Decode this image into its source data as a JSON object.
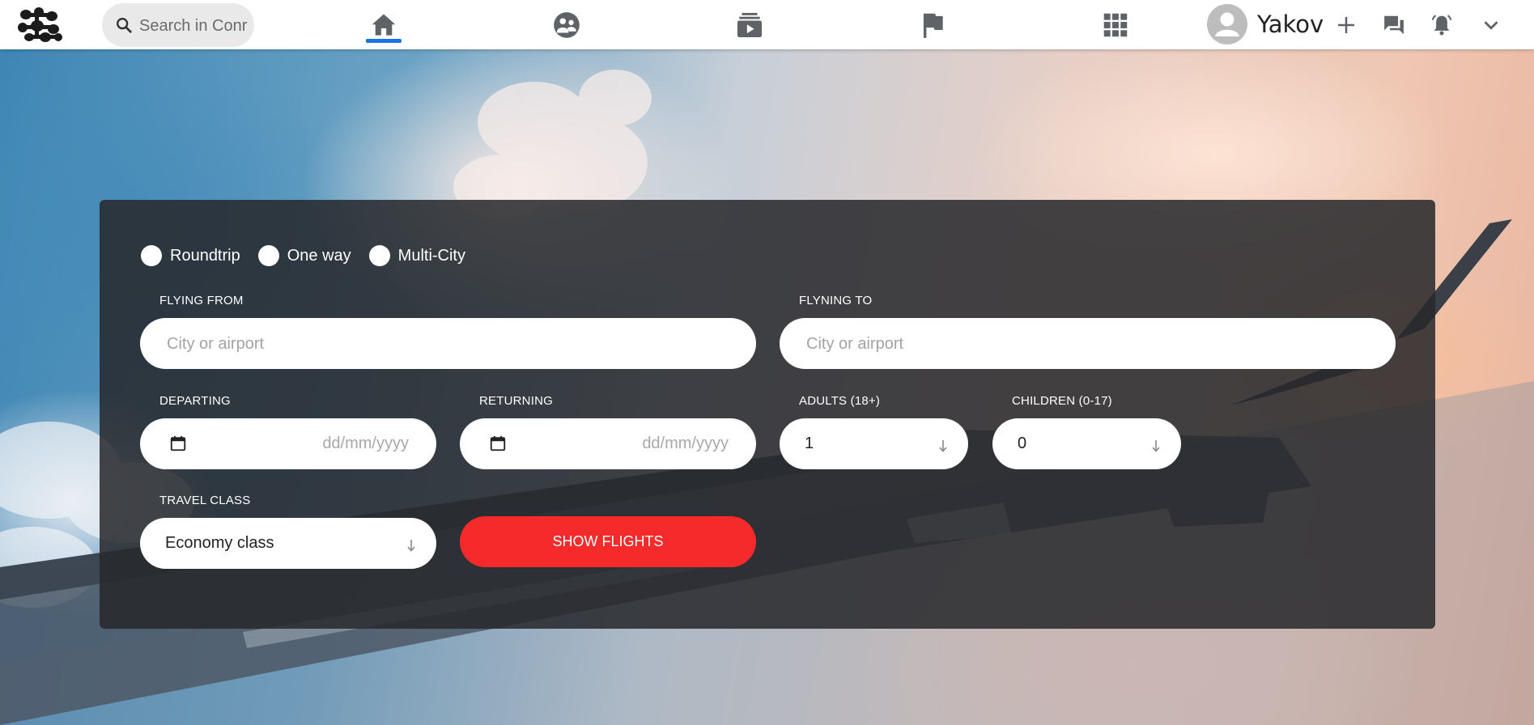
{
  "nav": {
    "search_placeholder": "Search in Conr",
    "username": "Yakov",
    "icons": [
      "logo-icon",
      "search-icon",
      "home-icon",
      "groups-icon",
      "watch-icon",
      "flag-icon",
      "apps-icon",
      "avatar-icon",
      "plus-icon",
      "chat-icon",
      "bell-icon",
      "chevron-down-icon"
    ],
    "active_tab": "home",
    "accent_color": "#1a73e8"
  },
  "form": {
    "trip_types": [
      {
        "label": "Roundtrip"
      },
      {
        "label": "One way"
      },
      {
        "label": "Multi-City"
      }
    ],
    "from": {
      "label": "FLYING FROM",
      "placeholder": "City or airport"
    },
    "to": {
      "label": "FLYNING TO",
      "placeholder": "City or airport"
    },
    "departing": {
      "label": "DEPARTING",
      "placeholder": "dd/mm/yyyy"
    },
    "returning": {
      "label": "RETURNING",
      "placeholder": "dd/mm/yyyy"
    },
    "adults": {
      "label": "ADULTS (18+)",
      "value": "1"
    },
    "children": {
      "label": "CHILDREN (0-17)",
      "value": "0"
    },
    "travel_class": {
      "label": "TRAVEL CLASS",
      "value": "Economy class"
    },
    "submit_label": "SHOW FLIGHTS",
    "submit_color": "#f62a2a"
  }
}
